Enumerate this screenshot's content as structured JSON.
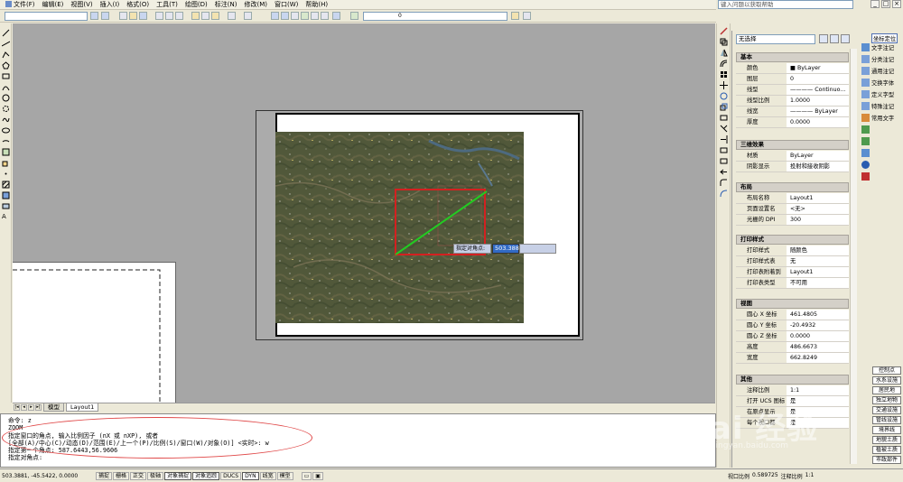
{
  "menu": [
    {
      "label": "文件(F)"
    },
    {
      "label": "编辑(E)"
    },
    {
      "label": "视图(V)"
    },
    {
      "label": "插入(I)"
    },
    {
      "label": "格式(O)"
    },
    {
      "label": "工具(T)"
    },
    {
      "label": "绘图(D)"
    },
    {
      "label": "标注(N)"
    },
    {
      "label": "修改(M)"
    },
    {
      "label": "窗口(W)"
    },
    {
      "label": "帮助(H)"
    }
  ],
  "help_search": {
    "placeholder": "键入问题以获取帮助"
  },
  "layer": {
    "current": "0"
  },
  "dynamic_input": {
    "label": "指定对角点:",
    "value": "503.3881"
  },
  "layout_tabs": [
    {
      "label": "模型"
    },
    {
      "label": "Layout1"
    }
  ],
  "command": {
    "lines": [
      "命令: z",
      "ZOOM",
      "指定窗口的角点, 输入比例因子 (nX 或 nXP), 或者",
      "[全部(A)/中心(C)/动态(D)/范围(E)/上一个(P)/比例(S)/窗口(W)/对象(O)] <实时>: w",
      "指定第一个角点: 587.6443,56.9606",
      "指定对角点:"
    ]
  },
  "status": {
    "coords": "503.3881, -45.5422, 0.0000",
    "toggles": [
      {
        "label": "捕捉",
        "on": false
      },
      {
        "label": "栅格",
        "on": false
      },
      {
        "label": "正交",
        "on": false
      },
      {
        "label": "极轴",
        "on": false
      },
      {
        "label": "对象捕捉",
        "on": true
      },
      {
        "label": "对象追踪",
        "on": true
      },
      {
        "label": "DUCS",
        "on": false
      },
      {
        "label": "DYN",
        "on": true
      },
      {
        "label": "线宽",
        "on": false
      },
      {
        "label": "模型",
        "on": false
      }
    ],
    "viewport_scale_label": "视口比例",
    "viewport_scale_value": "0.589725",
    "annot_scale_label": "注释比例",
    "annot_scale_value": "1:1"
  },
  "properties": {
    "selection": "无选择",
    "sections": [
      {
        "title": "基本",
        "rows": [
          {
            "k": "颜色",
            "v": "■ ByLayer"
          },
          {
            "k": "图层",
            "v": "0"
          },
          {
            "k": "线型",
            "v": "———— Continuo..."
          },
          {
            "k": "线型比例",
            "v": "1.0000"
          },
          {
            "k": "线宽",
            "v": "———— ByLayer"
          },
          {
            "k": "厚度",
            "v": "0.0000"
          }
        ]
      },
      {
        "title": "三维效果",
        "rows": [
          {
            "k": "材质",
            "v": "ByLayer"
          },
          {
            "k": "阴影显示",
            "v": "投射和接收阴影"
          }
        ]
      },
      {
        "title": "布局",
        "rows": [
          {
            "k": "布局名称",
            "v": "Layout1"
          },
          {
            "k": "页面设置名",
            "v": "<无>"
          },
          {
            "k": "光栅的 DPI",
            "v": "300"
          }
        ]
      },
      {
        "title": "打印样式",
        "rows": [
          {
            "k": "打印样式",
            "v": "随颜色"
          },
          {
            "k": "打印样式表",
            "v": "无"
          },
          {
            "k": "打印表附着到",
            "v": "Layout1"
          },
          {
            "k": "打印表类型",
            "v": "不可用"
          }
        ]
      },
      {
        "title": "视图",
        "rows": [
          {
            "k": "圆心 X 坐标",
            "v": "461.4805"
          },
          {
            "k": "圆心 Y 坐标",
            "v": "-20.4932"
          },
          {
            "k": "圆心 Z 坐标",
            "v": "0.0000"
          },
          {
            "k": "高度",
            "v": "486.6673"
          },
          {
            "k": "宽度",
            "v": "662.8249"
          }
        ]
      },
      {
        "title": "其他",
        "rows": [
          {
            "k": "注释比例",
            "v": "1:1"
          },
          {
            "k": "打开 UCS 图标",
            "v": "是"
          },
          {
            "k": "在原点显示",
            "v": "是"
          },
          {
            "k": "每个视口都",
            "v": "是"
          }
        ]
      }
    ]
  },
  "right_dock": {
    "labels": [
      "坐标定位",
      "文字注记",
      "分类注记",
      "通用注记",
      "交换字体",
      "定义字型",
      "特殊注记",
      "常用文字"
    ],
    "buttons": [
      "控制点",
      "水系设施",
      "居民地",
      "独立地物",
      "交通设施",
      "管线设施",
      "境界线",
      "地貌土质",
      "植被土质",
      "市政部件"
    ]
  },
  "watermark": {
    "text": "Bai 经验",
    "sub": "jingyan.baidu.com"
  },
  "colors": {
    "selection_rect": "#d42020",
    "rubber_band": "#22cc22",
    "dyn_value_bg": "#316ac5",
    "annotation_oval": "#e04848"
  }
}
